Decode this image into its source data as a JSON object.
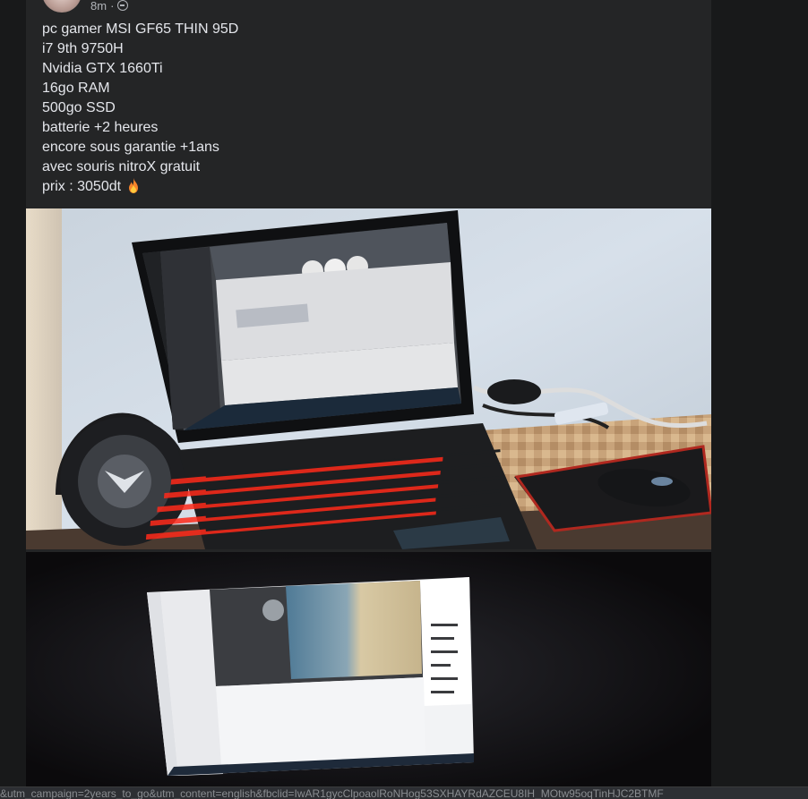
{
  "post": {
    "time": "8m",
    "text_lines": [
      "pc gamer MSI GF65 THIN 95D",
      "i7 9th 9750H",
      "Nvidia GTX 1660Ti",
      "16go RAM",
      "500go SSD",
      "batterie +2 heures",
      "encore sous garantie +1ans",
      "avec souris nitroX gratuit",
      "prix : 3050dt"
    ],
    "emoji_icon": "fire-icon",
    "privacy_icon": "globe-icon"
  },
  "photos": [
    {
      "kind": "laptop-on-desk-photo"
    },
    {
      "kind": "laptop-screen-dark-photo"
    }
  ],
  "status_bar": {
    "url": "&utm_campaign=2years_to_go&utm_content=english&fbclid=IwAR1gycClpoaolRoNHog53SXHAYRdAZCEU8IH_MOtw95oqTinHJC2BTMF"
  },
  "colors": {
    "background": "#18191a",
    "card": "#242526",
    "text": "#e4e6eb",
    "muted": "#b0b3b8",
    "keyboard_backlight": "#ff2a1a"
  }
}
